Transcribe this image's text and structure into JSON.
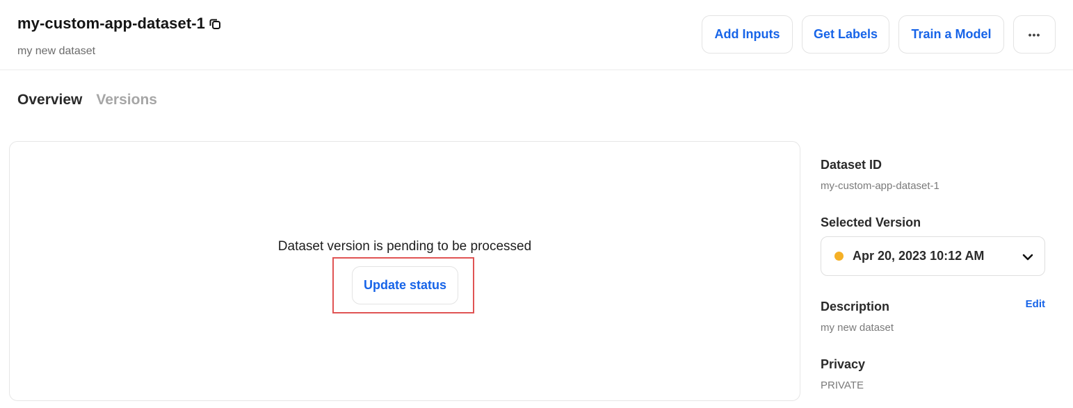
{
  "header": {
    "title": "my-custom-app-dataset-1",
    "subtitle": "my new dataset",
    "actions": {
      "add_inputs": "Add Inputs",
      "get_labels": "Get Labels",
      "train_model": "Train a Model",
      "more": "•••"
    }
  },
  "tabs": [
    {
      "label": "Overview",
      "active": true
    },
    {
      "label": "Versions",
      "active": false
    }
  ],
  "main": {
    "pending_message": "Dataset version is pending to be processed",
    "update_button": "Update status"
  },
  "sidebar": {
    "dataset_id_label": "Dataset ID",
    "dataset_id_value": "my-custom-app-dataset-1",
    "selected_version_label": "Selected Version",
    "selected_version_value": "Apr 20, 2023 10:12 AM",
    "description_label": "Description",
    "description_edit": "Edit",
    "description_value": "my new dataset",
    "privacy_label": "Privacy",
    "privacy_value": "PRIVATE"
  },
  "colors": {
    "accent": "#1764e8",
    "status_pending": "#f5b026",
    "highlight_border": "#e05353"
  },
  "icons": {
    "copy": "copy-icon",
    "chevron": "chevron-down-icon",
    "status": "status-dot"
  }
}
